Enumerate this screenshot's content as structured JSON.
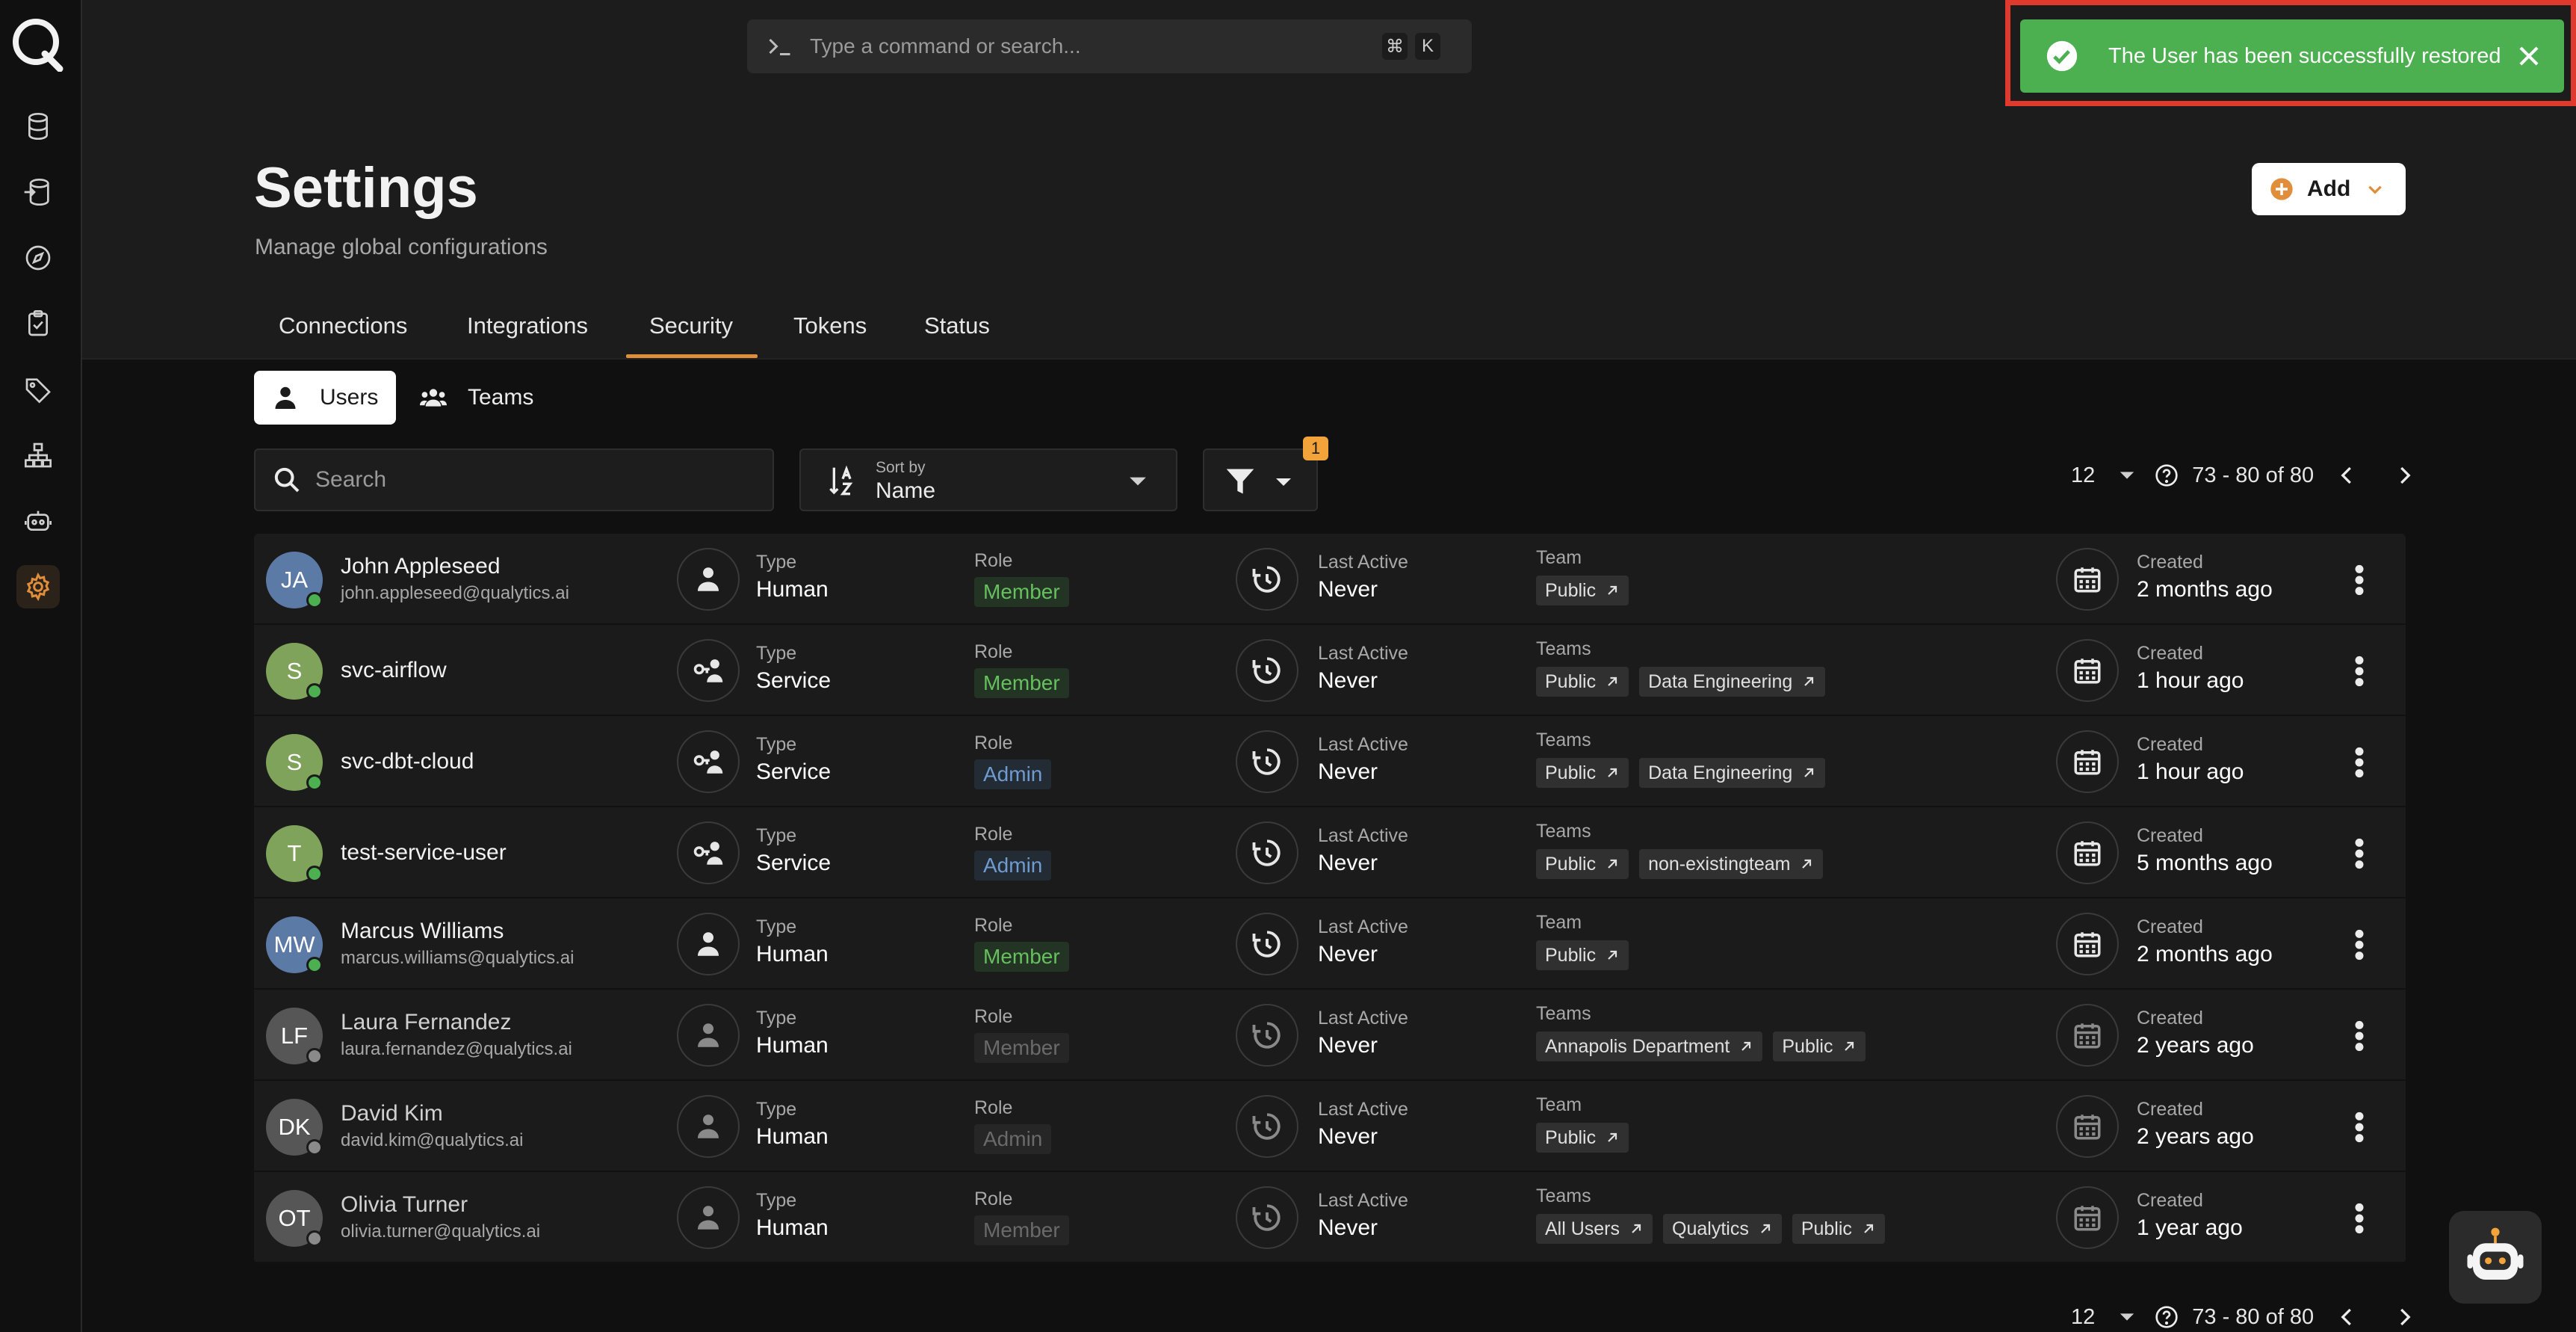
{
  "command_bar": {
    "placeholder": "Type a command or search...",
    "key1": "⌘",
    "key2": "K"
  },
  "toast": {
    "message": "The User has been successfully restored",
    "color": "#4caf50"
  },
  "header": {
    "title": "Settings",
    "subtitle": "Manage global configurations",
    "add_label": "Add"
  },
  "tabs": [
    {
      "label": "Connections",
      "active": false
    },
    {
      "label": "Integrations",
      "active": false
    },
    {
      "label": "Security",
      "active": true
    },
    {
      "label": "Tokens",
      "active": false
    },
    {
      "label": "Status",
      "active": false
    }
  ],
  "subtabs": [
    {
      "label": "Users",
      "icon": "user-icon",
      "active": true
    },
    {
      "label": "Teams",
      "icon": "team-icon",
      "active": false
    }
  ],
  "filters": {
    "search_placeholder": "Search",
    "sort_label": "Sort by",
    "sort_value": "Name",
    "filter_count": "1"
  },
  "pagination": {
    "page_size": "12",
    "range": "73 - 80 of 80"
  },
  "labels": {
    "type": "Type",
    "role": "Role",
    "last_active": "Last Active",
    "team": "Team",
    "teams": "Teams",
    "created": "Created"
  },
  "accent_color": "#e08e3c",
  "users": [
    {
      "initials": "JA",
      "name": "John Appleseed",
      "email": "john.appleseed@qualytics.ai",
      "avatar_color": "#5b7ba6",
      "online": true,
      "type": "Human",
      "role": "Member",
      "role_style": "member",
      "last_active": "Never",
      "team_label": "Team",
      "teams": [
        "Public"
      ],
      "created": "2 months ago",
      "active": true
    },
    {
      "initials": "S",
      "name": "svc-airflow",
      "email": "",
      "avatar_color": "#7fa35a",
      "online": true,
      "type": "Service",
      "role": "Member",
      "role_style": "member",
      "last_active": "Never",
      "team_label": "Teams",
      "teams": [
        "Public",
        "Data Engineering"
      ],
      "created": "1 hour ago",
      "active": true
    },
    {
      "initials": "S",
      "name": "svc-dbt-cloud",
      "email": "",
      "avatar_color": "#7fa35a",
      "online": true,
      "type": "Service",
      "role": "Admin",
      "role_style": "admin",
      "last_active": "Never",
      "team_label": "Teams",
      "teams": [
        "Public",
        "Data Engineering"
      ],
      "created": "1 hour ago",
      "active": true
    },
    {
      "initials": "T",
      "name": "test-service-user",
      "email": "",
      "avatar_color": "#7fa35a",
      "online": true,
      "type": "Service",
      "role": "Admin",
      "role_style": "admin",
      "last_active": "Never",
      "team_label": "Teams",
      "teams": [
        "Public",
        "non-existingteam"
      ],
      "created": "5 months ago",
      "active": true
    },
    {
      "initials": "MW",
      "name": "Marcus Williams",
      "email": "marcus.williams@qualytics.ai",
      "avatar_color": "#5b7ba6",
      "online": true,
      "type": "Human",
      "role": "Member",
      "role_style": "member",
      "last_active": "Never",
      "team_label": "Team",
      "teams": [
        "Public"
      ],
      "created": "2 months ago",
      "active": true
    },
    {
      "initials": "LF",
      "name": "Laura Fernandez",
      "email": "laura.fernandez@qualytics.ai",
      "avatar_color": "#565656",
      "online": false,
      "type": "Human",
      "role": "Member",
      "role_style": "dmember",
      "last_active": "Never",
      "team_label": "Teams",
      "teams": [
        "Annapolis Department",
        "Public"
      ],
      "created": "2 years ago",
      "active": false
    },
    {
      "initials": "DK",
      "name": "David Kim",
      "email": "david.kim@qualytics.ai",
      "avatar_color": "#565656",
      "online": false,
      "type": "Human",
      "role": "Admin",
      "role_style": "dadmin",
      "last_active": "Never",
      "team_label": "Team",
      "teams": [
        "Public"
      ],
      "created": "2 years ago",
      "active": false
    },
    {
      "initials": "OT",
      "name": "Olivia Turner",
      "email": "olivia.turner@qualytics.ai",
      "avatar_color": "#565656",
      "online": false,
      "type": "Human",
      "role": "Member",
      "role_style": "dmember",
      "last_active": "Never",
      "team_label": "Teams",
      "teams": [
        "All Users",
        "Qualytics",
        "Public"
      ],
      "created": "1 year ago",
      "active": false
    }
  ]
}
